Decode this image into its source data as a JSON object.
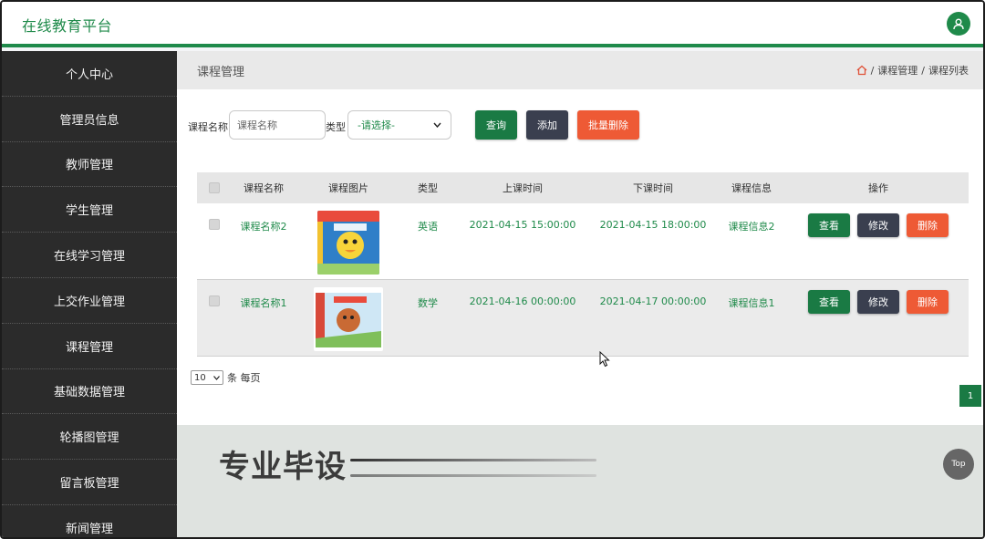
{
  "header": {
    "brand": "在线教育平台",
    "user_icon": "user-icon"
  },
  "sidebar": {
    "items": [
      {
        "label": "个人中心"
      },
      {
        "label": "管理员信息"
      },
      {
        "label": "教师管理"
      },
      {
        "label": "学生管理"
      },
      {
        "label": "在线学习管理"
      },
      {
        "label": "上交作业管理"
      },
      {
        "label": "课程管理"
      },
      {
        "label": "基础数据管理"
      },
      {
        "label": "轮播图管理"
      },
      {
        "label": "留言板管理"
      },
      {
        "label": "新闻管理"
      }
    ]
  },
  "page": {
    "title": "课程管理",
    "breadcrumb": [
      "课程管理",
      "课程列表"
    ]
  },
  "filter": {
    "name_label": "课程名称",
    "name_placeholder": "课程名称",
    "type_label": "类型",
    "type_selected": "-请选择-",
    "query": "查询",
    "add": "添加",
    "batch_delete": "批量删除"
  },
  "table": {
    "headers": [
      "课程名称",
      "课程图片",
      "类型",
      "上课时间",
      "下课时间",
      "课程信息",
      "操作"
    ],
    "rows": [
      {
        "name": "课程名称2",
        "type": "英语",
        "start": "2021-04-15 15:00:00",
        "end": "2021-04-15 18:00:00",
        "info": "课程信息2",
        "view": "查看",
        "edit": "修改",
        "del": "删除"
      },
      {
        "name": "课程名称1",
        "type": "数学",
        "start": "2021-04-16 00:00:00",
        "end": "2021-04-17 00:00:00",
        "info": "课程信息1",
        "view": "查看",
        "edit": "修改",
        "del": "删除"
      }
    ]
  },
  "pager": {
    "per_page_value": "10",
    "per_page_suffix": "条 每页",
    "current_page": "1"
  },
  "overlay": {
    "watermark": "专业毕设",
    "top_button": "Top"
  },
  "colors": {
    "accent": "#1f8a4a",
    "sidebar_bg": "#2b2b2b",
    "edit_btn": "#3a3f4f",
    "delete_btn": "#ee5a35"
  }
}
